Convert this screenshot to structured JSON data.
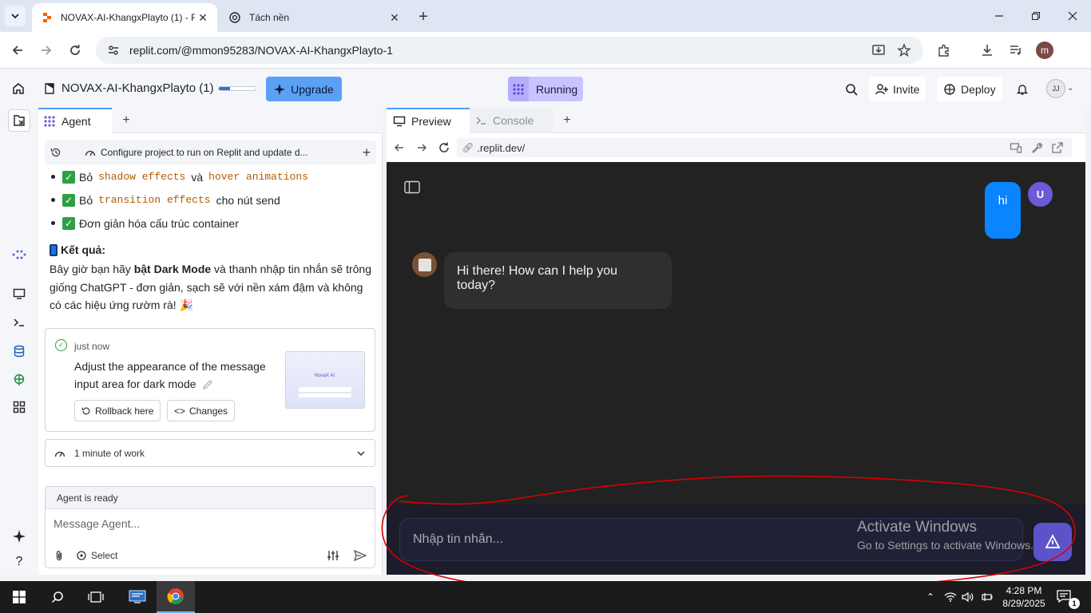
{
  "browser": {
    "tabs": [
      {
        "title": "NOVAX-AI-KhangxPlayto (1) - R",
        "active": true
      },
      {
        "title": "Tách nền",
        "active": false
      }
    ],
    "url": "replit.com/@mmon95283/NOVAX-AI-KhangxPlayto-1",
    "profile_initial": "m"
  },
  "header": {
    "project_name": "NOVAX-AI-KhangxPlayto (1)",
    "progress": 0.3,
    "upgrade_label": "Upgrade",
    "status_label": "Running",
    "invite_label": "Invite",
    "deploy_label": "Deploy",
    "user_initials": "JJ"
  },
  "agent": {
    "tab_label": "Agent",
    "task_text": "Configure project to run on Replit and update d...",
    "bullets": [
      {
        "pre": "Bỏ",
        "code1": "shadow effects",
        "mid": "và",
        "code2": "hover animations",
        "post": ""
      },
      {
        "pre": "Bỏ",
        "code1": "transition effects",
        "mid": "cho nút send",
        "code2": "",
        "post": ""
      },
      {
        "pre": "Đơn giản hóa cấu trúc container",
        "code1": "",
        "mid": "",
        "code2": "",
        "post": ""
      }
    ],
    "result_title": "Kết quả:",
    "result_p1": "Bây giờ bạn hãy ",
    "result_bold": "bật Dark Mode",
    "result_p2": " và thanh nhập tin nhắn sẽ trông giống ChatGPT - đơn giản, sạch sẽ với nền xám đậm và không có các hiệu ứng rườm rà! 🎉",
    "checkpoint": {
      "time": "just now",
      "description": "Adjust the appearance of the message input area for dark mode",
      "rollback_label": "Rollback here",
      "changes_label": "Changes",
      "thumb_title": "NovaX AI"
    },
    "work_label": "1 minute of work",
    "status": "Agent is ready",
    "input_placeholder": "Message Agent...",
    "select_label": "Select"
  },
  "preview": {
    "tab_preview": "Preview",
    "tab_console": "Console",
    "url": ".replit.dev/",
    "app": {
      "user_message": "hi",
      "user_avatar": "U",
      "bot_message": "Hi there! How can I help you today?",
      "input_placeholder": "Nhập tin nhắn..."
    }
  },
  "watermark": {
    "line1": "Activate Windows",
    "line2": "Go to Settings to activate Windows."
  },
  "taskbar": {
    "time": "4:28 PM",
    "date": "8/29/2025",
    "notifications": "1"
  },
  "colors": {
    "accent": "#0a84ff",
    "send_button": "#5d53c9",
    "annotation": "#d90000",
    "upgrade": "#5aa1f6",
    "running": "#c9c4ff"
  }
}
